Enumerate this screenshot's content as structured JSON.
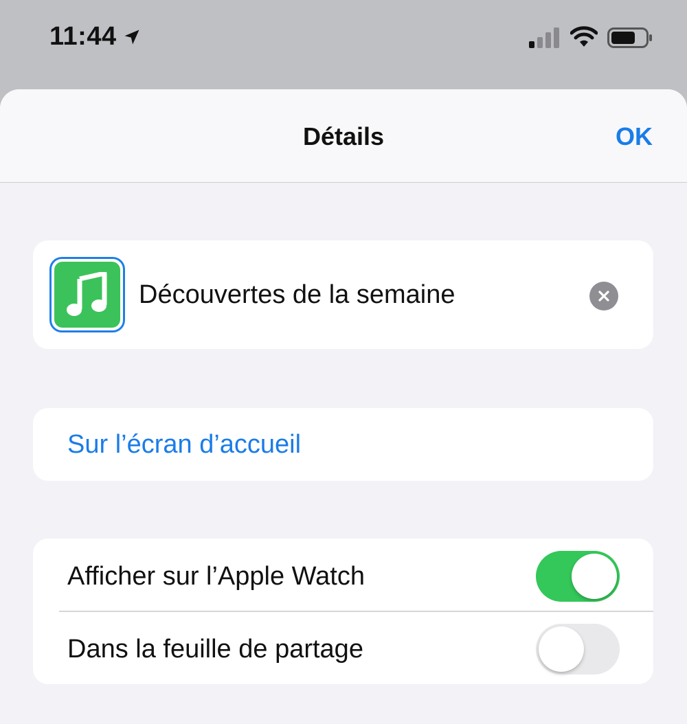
{
  "status_bar": {
    "time": "11:44",
    "location_icon": "location-arrow-icon",
    "signal_icon": "cellular-signal-icon",
    "wifi_icon": "wifi-icon",
    "battery_icon": "battery-icon"
  },
  "nav": {
    "title": "Détails",
    "ok_label": "OK"
  },
  "shortcut": {
    "icon": "music-note-icon",
    "icon_color": "#3cc25a",
    "name": "Découvertes de la semaine",
    "clear_icon": "clear-x-icon"
  },
  "home_screen": {
    "label": "Sur l’écran d’accueil"
  },
  "toggles": [
    {
      "label": "Afficher sur l’Apple Watch",
      "on": true
    },
    {
      "label": "Dans la feuille de partage",
      "on": false
    }
  ],
  "colors": {
    "accent": "#1a7ce8",
    "switch_on": "#34c759",
    "background": "#f2f2f7"
  }
}
